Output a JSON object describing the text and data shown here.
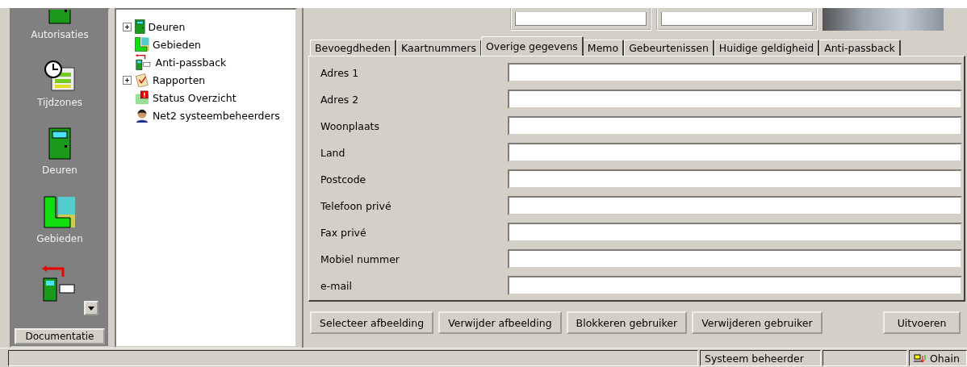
{
  "sidebar": {
    "items": [
      {
        "label": "Autorisaties",
        "kind": "door"
      },
      {
        "label": "Tijdzones",
        "kind": "clock"
      },
      {
        "label": "Deuren",
        "kind": "door"
      },
      {
        "label": "Gebieden",
        "kind": "area"
      },
      {
        "kind": "passback"
      }
    ],
    "footer_button": "Documentatie"
  },
  "tree": {
    "items": [
      {
        "label": "Deuren",
        "kind": "door",
        "expandable": true
      },
      {
        "label": "Gebieden",
        "kind": "area",
        "expandable": false
      },
      {
        "label": "Anti-passback",
        "kind": "passback",
        "expandable": false
      },
      {
        "label": "Rapporten",
        "kind": "report",
        "expandable": true
      },
      {
        "label": "Status Overzicht",
        "kind": "status",
        "expandable": false
      },
      {
        "label": "Net2 systeembeheerders",
        "kind": "admin",
        "expandable": false
      }
    ]
  },
  "tabs": [
    {
      "label": "Bevoegdheden",
      "selected": false
    },
    {
      "label": "Kaartnummers",
      "selected": false
    },
    {
      "label": "Overige gegevens",
      "selected": true
    },
    {
      "label": "Memo",
      "selected": false
    },
    {
      "label": "Gebeurtenissen",
      "selected": false
    },
    {
      "label": "Huidige geldigheid",
      "selected": false
    },
    {
      "label": "Anti-passback",
      "selected": false
    }
  ],
  "fields": [
    {
      "label": "Adres 1"
    },
    {
      "label": "Adres 2"
    },
    {
      "label": "Woonplaats"
    },
    {
      "label": "Land"
    },
    {
      "label": "Postcode"
    },
    {
      "label": "Telefoon privé"
    },
    {
      "label": "Fax privé"
    },
    {
      "label": "Mobiel nummer"
    },
    {
      "label": "e-mail"
    }
  ],
  "buttons": [
    "Selecteer afbeelding",
    "Verwijder afbeelding",
    "Blokkeren gebruiker",
    "Verwijderen gebruiker"
  ],
  "run_button": "Uitvoeren",
  "status_bar": {
    "user": "Systeem beheerder",
    "connection": "Ohain"
  }
}
